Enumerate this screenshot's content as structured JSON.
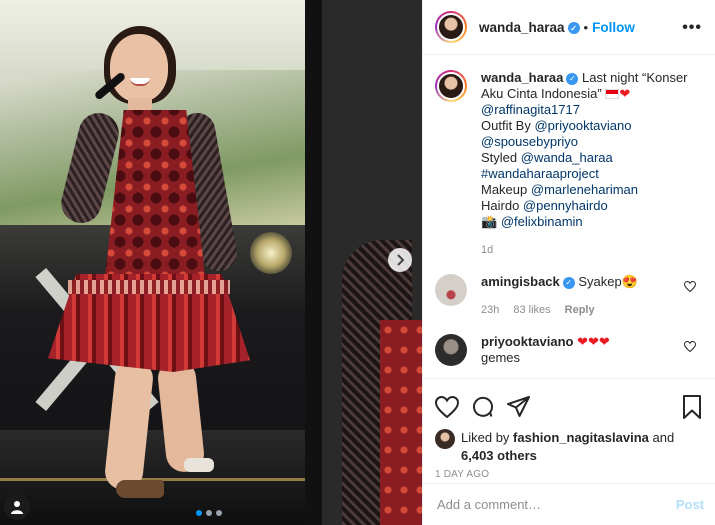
{
  "post": {
    "username": "wanda_haraa",
    "dot": "•",
    "follow_label": "Follow",
    "more_label": "•••"
  },
  "caption": {
    "username": "wanda_haraa",
    "text_before": "Last night “Konser Aku Cinta Indonesia”",
    "lines": [
      {
        "mention": "@raffinagita1717",
        "prefix": ""
      },
      {
        "prefix": "Outfit By ",
        "mention": "@priyooktaviano"
      },
      {
        "prefix": "",
        "mention": "@spousebypriyo"
      },
      {
        "prefix": "Styled ",
        "mention": "@wanda_haraa"
      },
      {
        "prefix": "",
        "mention": "#wandaharaaproject"
      },
      {
        "prefix": "Makeup ",
        "mention": "@marlenehariman"
      },
      {
        "prefix": "Hairdo ",
        "mention": "@pennyhairdo"
      },
      {
        "prefix": "📸 ",
        "mention": "@felixbinamin"
      }
    ],
    "age": "1d"
  },
  "comments": [
    {
      "username": "amingisback",
      "text": "Syakep",
      "emoji": "😍",
      "age": "23h",
      "likes": "83 likes",
      "reply": "Reply"
    },
    {
      "username": "priyooktaviano",
      "text": "❤❤❤",
      "text2": "gemes"
    }
  ],
  "likes": {
    "prefix": "Liked by ",
    "user": "fashion_nagitaslavina",
    "and": " and",
    "others": "6,403 others"
  },
  "time_ago": "1 DAY AGO",
  "comment_box": {
    "placeholder": "Add a comment…",
    "post_label": "Post"
  },
  "carousel": {
    "slides": 3,
    "active": 1
  },
  "colors": {
    "accent": "#0095f6",
    "link": "#00376b",
    "muted": "#8e8e8e",
    "verified": "#3897f0",
    "heart": "#ed1c24"
  }
}
